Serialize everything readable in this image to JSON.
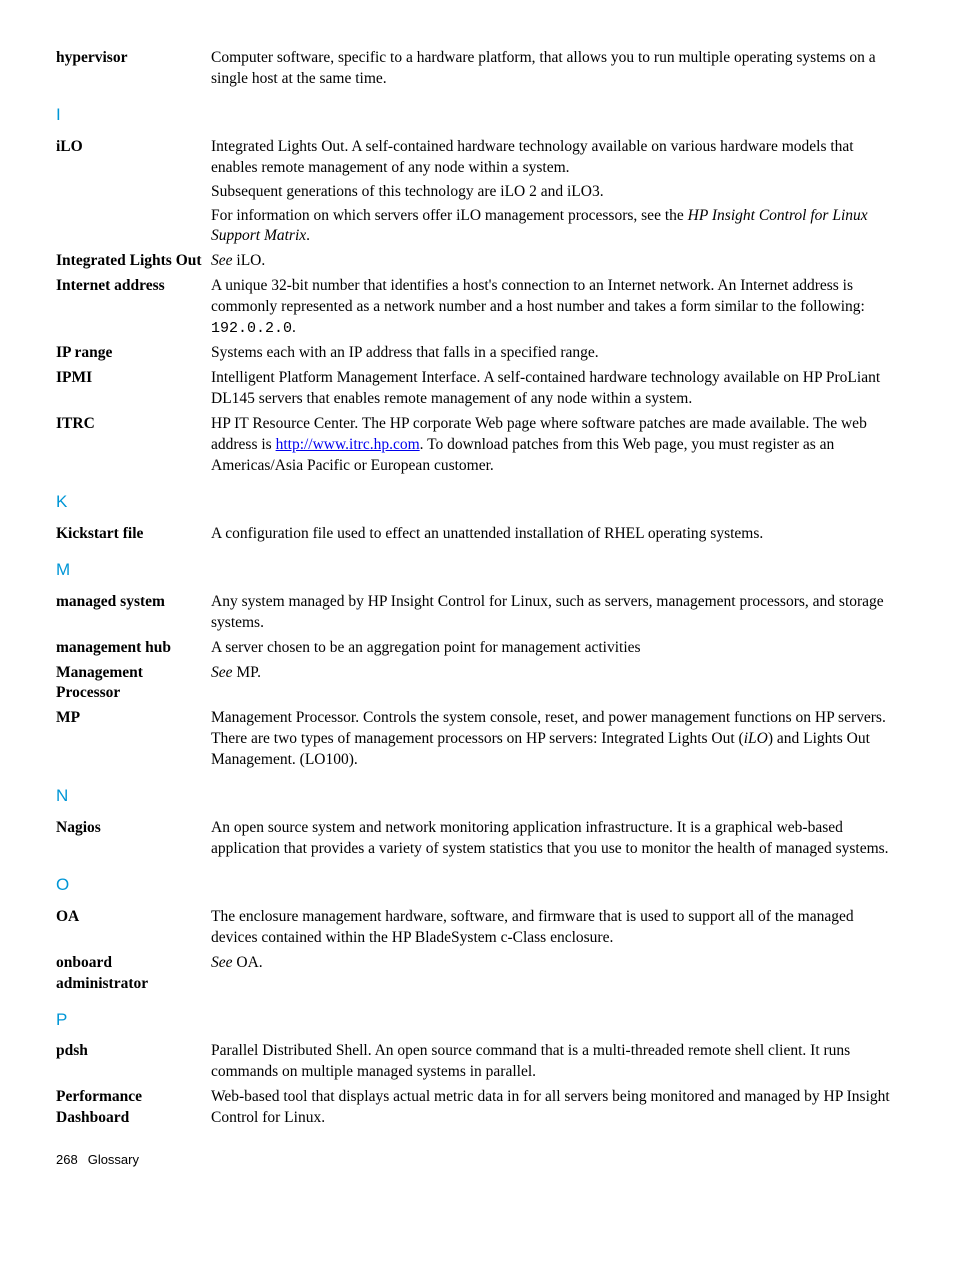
{
  "entries": [
    {
      "term": "hypervisor",
      "paragraphs": [
        [
          {
            "t": "Computer software, specific to a hardware platform, that allows you to run multiple operating systems on a single host at the same time."
          }
        ]
      ]
    }
  ],
  "section_I": "I",
  "entries_I": [
    {
      "term": "iLO",
      "paragraphs": [
        [
          {
            "t": "Integrated Lights Out. A self-contained hardware technology available on various hardware models that enables remote management of any node within a system."
          }
        ],
        [
          {
            "t": "Subsequent generations of this technology are iLO 2 and iLO3."
          }
        ],
        [
          {
            "t": "For information on which servers offer iLO management processors, see the "
          },
          {
            "t": "HP Insight Control for Linux Support Matrix",
            "style": "italic"
          },
          {
            "t": "."
          }
        ]
      ]
    },
    {
      "term": "Integrated Lights Out",
      "paragraphs": [
        [
          {
            "t": "See",
            "style": "see"
          },
          {
            "t": " iLO."
          }
        ]
      ]
    },
    {
      "term": "Internet address",
      "paragraphs": [
        [
          {
            "t": "A unique 32-bit number that identifies a host's connection to an Internet network. An Internet address is commonly represented as a network number and a host number and takes a form similar to the following: "
          },
          {
            "t": "192.0.2.0",
            "style": "mono"
          },
          {
            "t": "."
          }
        ]
      ]
    },
    {
      "term": "IP range",
      "paragraphs": [
        [
          {
            "t": "Systems each with an IP address that falls in a specified range."
          }
        ]
      ]
    },
    {
      "term": "IPMI",
      "paragraphs": [
        [
          {
            "t": "Intelligent Platform Management Interface. A self-contained hardware technology available on HP ProLiant DL145 servers that enables remote management of any node within a system."
          }
        ]
      ]
    },
    {
      "term": "ITRC",
      "paragraphs": [
        [
          {
            "t": "HP IT Resource Center. The HP corporate Web page where software patches are made available. The web address is "
          },
          {
            "t": "http://www.itrc.hp.com",
            "style": "link"
          },
          {
            "t": ". To download patches from this Web page, you must register as an Americas/Asia Pacific or European customer."
          }
        ]
      ]
    }
  ],
  "section_K": "K",
  "entries_K": [
    {
      "term": "Kickstart file",
      "paragraphs": [
        [
          {
            "t": "A configuration file used to effect an unattended installation of RHEL operating systems."
          }
        ]
      ]
    }
  ],
  "section_M": "M",
  "entries_M": [
    {
      "term": "managed system",
      "paragraphs": [
        [
          {
            "t": "Any system managed by HP Insight Control for Linux, such as servers, management processors, and storage systems."
          }
        ]
      ]
    },
    {
      "term": "management hub",
      "paragraphs": [
        [
          {
            "t": "A server chosen to be an aggregation point for management activities"
          }
        ]
      ]
    },
    {
      "term": "Management Processor",
      "paragraphs": [
        [
          {
            "t": "See",
            "style": "see"
          },
          {
            "t": " MP."
          }
        ]
      ]
    },
    {
      "term": "MP",
      "paragraphs": [
        [
          {
            "t": "Management Processor. Controls the system console, reset, and power management functions on HP servers. There are two types of management processors on HP servers: Integrated Lights Out ("
          },
          {
            "t": "iLO",
            "style": "italic"
          },
          {
            "t": ") and Lights Out Management. (LO100)."
          }
        ]
      ]
    }
  ],
  "section_N": "N",
  "entries_N": [
    {
      "term": "Nagios",
      "paragraphs": [
        [
          {
            "t": "An open source system and network monitoring application infrastructure. It is a graphical web-based application that provides a variety of system statistics that you use to monitor the health of managed systems."
          }
        ]
      ]
    }
  ],
  "section_O": "O",
  "entries_O": [
    {
      "term": "OA",
      "paragraphs": [
        [
          {
            "t": "The enclosure management hardware, software, and firmware that is used to support all of the managed devices contained within the HP BladeSystem c-Class enclosure."
          }
        ]
      ]
    },
    {
      "term": "onboard administrator",
      "paragraphs": [
        [
          {
            "t": "See",
            "style": "see"
          },
          {
            "t": " OA."
          }
        ]
      ]
    }
  ],
  "section_P": "P",
  "entries_P": [
    {
      "term": "pdsh",
      "paragraphs": [
        [
          {
            "t": "Parallel Distributed Shell. An open source command that is a multi-threaded remote shell client. It runs commands on multiple managed systems in parallel."
          }
        ]
      ]
    },
    {
      "term": "Performance Dashboard",
      "paragraphs": [
        [
          {
            "t": "Web-based tool that displays actual metric data in for all servers being monitored and managed by HP Insight Control for Linux."
          }
        ]
      ]
    }
  ],
  "footer": {
    "page": "268",
    "section": "Glossary"
  }
}
